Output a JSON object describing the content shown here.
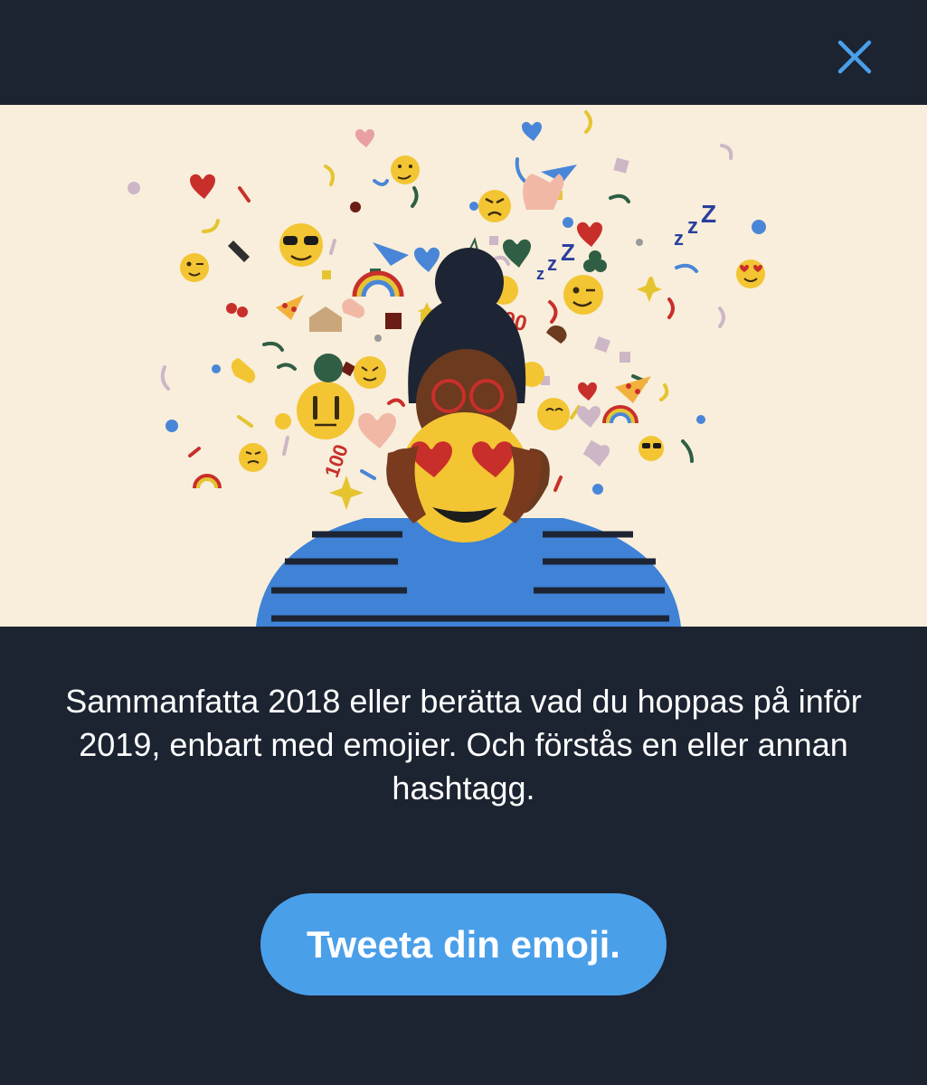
{
  "dialog": {
    "close_icon": "close-icon",
    "accent_color": "#4a9fe9",
    "background_color": "#1c2331"
  },
  "illustration": {
    "subject": "person-holding-heart-eyes-emoji-mask",
    "confetti_100_label": "100"
  },
  "message": {
    "text": "Sammanfatta 2018 eller berätta vad du hoppas på inför 2019, enbart med emojier. Och förstås en eller annan hashtagg."
  },
  "cta": {
    "label": "Tweeta din emoji."
  }
}
